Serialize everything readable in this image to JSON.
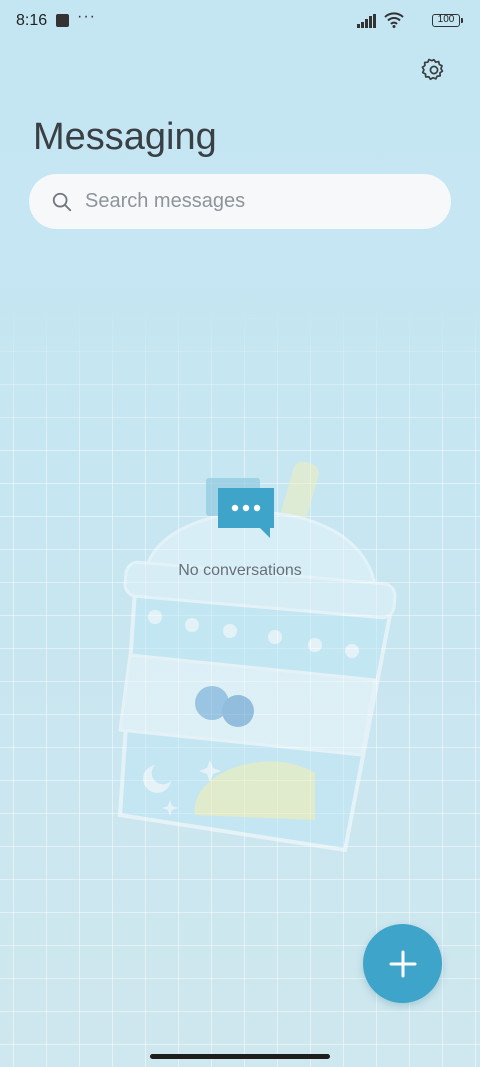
{
  "status_bar": {
    "time": "8:16",
    "dots": "···",
    "battery": "100"
  },
  "header": {
    "title": "Messaging",
    "settings_icon": "gear-icon"
  },
  "search": {
    "placeholder": "Search messages",
    "icon": "search-icon"
  },
  "empty_state": {
    "icon": "chat-bubble-icon",
    "text": "No conversations"
  },
  "fab": {
    "icon": "plus-icon",
    "color": "#3ea4c9"
  },
  "colors": {
    "background": "#c4e6f2",
    "accent": "#3ea4c9",
    "title": "#3a3f44"
  }
}
